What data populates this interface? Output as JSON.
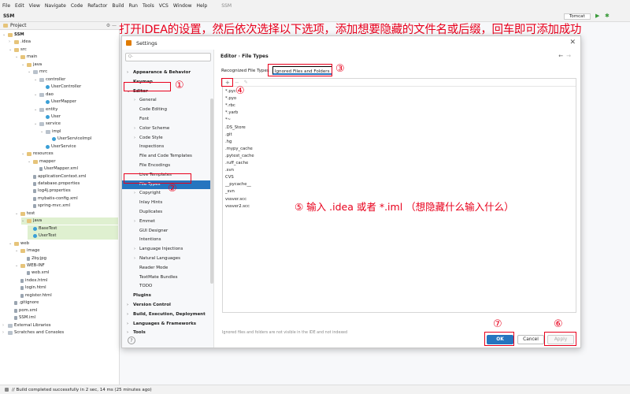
{
  "menu": [
    "File",
    "Edit",
    "View",
    "Navigate",
    "Code",
    "Refactor",
    "Build",
    "Run",
    "Tools",
    "VCS",
    "Window",
    "Help",
    "SSM"
  ],
  "toolbar": {
    "project_name": "SSM",
    "run_config": "Tomcat"
  },
  "project_panel": {
    "label": "Project"
  },
  "tree": [
    {
      "label": "SSM",
      "level": 0,
      "icon": "folder",
      "open": true
    },
    {
      "label": ".idea",
      "level": 1,
      "icon": "folder",
      "open": false
    },
    {
      "label": "src",
      "level": 1,
      "icon": "folder",
      "open": true
    },
    {
      "label": "main",
      "level": 2,
      "icon": "folder",
      "open": true
    },
    {
      "label": "java",
      "level": 3,
      "icon": "folder",
      "open": true
    },
    {
      "label": "mrc",
      "level": 4,
      "icon": "pkg",
      "open": true
    },
    {
      "label": "controller",
      "level": 5,
      "icon": "pkg",
      "open": true
    },
    {
      "label": "UserController",
      "level": 6,
      "icon": "cls"
    },
    {
      "label": "dao",
      "level": 5,
      "icon": "pkg",
      "open": true
    },
    {
      "label": "UserMapper",
      "level": 6,
      "icon": "cls"
    },
    {
      "label": "entity",
      "level": 5,
      "icon": "pkg",
      "open": true
    },
    {
      "label": "User",
      "level": 6,
      "icon": "cls"
    },
    {
      "label": "service",
      "level": 5,
      "icon": "pkg",
      "open": true
    },
    {
      "label": "impl",
      "level": 6,
      "icon": "pkg",
      "open": true
    },
    {
      "label": "UserServiceImpl",
      "level": 7,
      "icon": "cls"
    },
    {
      "label": "UserService",
      "level": 6,
      "icon": "cls"
    },
    {
      "label": "resources",
      "level": 3,
      "icon": "folder",
      "open": true
    },
    {
      "label": "mapper",
      "level": 4,
      "icon": "folder",
      "open": true
    },
    {
      "label": "UserMapper.xml",
      "level": 5,
      "icon": "file"
    },
    {
      "label": "applicationContext.xml",
      "level": 4,
      "icon": "file"
    },
    {
      "label": "database.properties",
      "level": 4,
      "icon": "file"
    },
    {
      "label": "log4j.properties",
      "level": 4,
      "icon": "file"
    },
    {
      "label": "mybatis-config.xml",
      "level": 4,
      "icon": "file"
    },
    {
      "label": "spring-mvc.xml",
      "level": 4,
      "icon": "file"
    },
    {
      "label": "test",
      "level": 2,
      "icon": "folder",
      "open": true
    },
    {
      "label": "java",
      "level": 3,
      "icon": "folder",
      "open": true,
      "highlight": true
    },
    {
      "label": "BaseTest",
      "level": 4,
      "icon": "cls",
      "highlight": true
    },
    {
      "label": "UserTest",
      "level": 4,
      "icon": "cls",
      "highlight": true
    },
    {
      "label": "web",
      "level": 1,
      "icon": "folder",
      "open": true
    },
    {
      "label": "image",
      "level": 2,
      "icon": "folder",
      "open": true
    },
    {
      "label": "2by.jpg",
      "level": 3,
      "icon": "file"
    },
    {
      "label": "WEB-INF",
      "level": 2,
      "icon": "folder",
      "open": true
    },
    {
      "label": "web.xml",
      "level": 3,
      "icon": "file"
    },
    {
      "label": "index.html",
      "level": 2,
      "icon": "file"
    },
    {
      "label": "login.html",
      "level": 2,
      "icon": "file"
    },
    {
      "label": "register.html",
      "level": 2,
      "icon": "file"
    },
    {
      "label": ".gitignore",
      "level": 1,
      "icon": "file"
    },
    {
      "label": "pom.xml",
      "level": 1,
      "icon": "file"
    },
    {
      "label": "SSM.iml",
      "level": 1,
      "icon": "file"
    },
    {
      "label": "External Libraries",
      "level": 0,
      "icon": "pkg",
      "open": false
    },
    {
      "label": "Scratches and Consoles",
      "level": 0,
      "icon": "pkg",
      "open": false
    }
  ],
  "annotation_title": "打开IDEA的设置，然后依次选择以下选项，添加想要隐藏的文件名或后缀，回车即可添加成功",
  "dialog": {
    "title": "Settings",
    "search_placeholder": "Q-",
    "breadcrumb": [
      "Editor",
      "File Types"
    ],
    "sidebar": [
      {
        "label": "Appearance & Behavior",
        "indent": 0,
        "bold": true,
        "arrow": "›"
      },
      {
        "label": "Keymap",
        "indent": 0,
        "bold": true,
        "arrow": ""
      },
      {
        "label": "Editor",
        "indent": 0,
        "bold": true,
        "arrow": "⌄"
      },
      {
        "label": "General",
        "indent": 1,
        "arrow": "›"
      },
      {
        "label": "Code Editing",
        "indent": 1,
        "arrow": ""
      },
      {
        "label": "Font",
        "indent": 1,
        "arrow": ""
      },
      {
        "label": "Color Scheme",
        "indent": 1,
        "arrow": "›"
      },
      {
        "label": "Code Style",
        "indent": 1,
        "arrow": "›"
      },
      {
        "label": "Inspections",
        "indent": 1,
        "arrow": ""
      },
      {
        "label": "File and Code Templates",
        "indent": 1,
        "arrow": ""
      },
      {
        "label": "File Encodings",
        "indent": 1,
        "arrow": ""
      },
      {
        "label": "Live Templates",
        "indent": 1,
        "arrow": ""
      },
      {
        "label": "File Types",
        "indent": 1,
        "arrow": "",
        "selected": true
      },
      {
        "label": "Copyright",
        "indent": 1,
        "arrow": "›"
      },
      {
        "label": "Inlay Hints",
        "indent": 1,
        "arrow": ""
      },
      {
        "label": "Duplicates",
        "indent": 1,
        "arrow": ""
      },
      {
        "label": "Emmet",
        "indent": 1,
        "arrow": "›"
      },
      {
        "label": "GUI Designer",
        "indent": 1,
        "arrow": ""
      },
      {
        "label": "Intentions",
        "indent": 1,
        "arrow": ""
      },
      {
        "label": "Language Injections",
        "indent": 1,
        "arrow": "›"
      },
      {
        "label": "Natural Languages",
        "indent": 1,
        "arrow": "›"
      },
      {
        "label": "Reader Mode",
        "indent": 1,
        "arrow": ""
      },
      {
        "label": "TextMate Bundles",
        "indent": 1,
        "arrow": ""
      },
      {
        "label": "TODO",
        "indent": 1,
        "arrow": ""
      },
      {
        "label": "Plugins",
        "indent": 0,
        "bold": true,
        "arrow": ""
      },
      {
        "label": "Version Control",
        "indent": 0,
        "bold": true,
        "arrow": "›"
      },
      {
        "label": "Build, Execution, Deployment",
        "indent": 0,
        "bold": true,
        "arrow": "›"
      },
      {
        "label": "Languages & Frameworks",
        "indent": 0,
        "bold": true,
        "arrow": "›"
      },
      {
        "label": "Tools",
        "indent": 0,
        "bold": true,
        "arrow": "›"
      }
    ],
    "tabs": [
      "Recognized File Types",
      "Ignored Files and Folders"
    ],
    "ignored": [
      "*.pyc",
      "*.pyo",
      "*.rbc",
      "*.yarb",
      "*~",
      ".DS_Store",
      ".git",
      ".hg",
      ".mypy_cache",
      ".pytest_cache",
      ".ruff_cache",
      ".svn",
      "CVS",
      "__pycache__",
      "_svn",
      "vssver.scc",
      "vssver2.scc"
    ],
    "hint": "Ignored files and folders are not visible in the IDE and not indexed",
    "buttons": {
      "ok": "OK",
      "cancel": "Cancel",
      "apply": "Apply"
    },
    "help": "?"
  },
  "annotations": {
    "n1": "①",
    "n2": "②",
    "n3": "③",
    "n4": "④",
    "n6": "⑥",
    "n7": "⑦",
    "step5": "⑤ 输入 .idea 或者 *.iml （想隐藏什么输入什么）"
  },
  "status": "// Build completed successfully in 2 sec, 14 ms (25 minutes ago)",
  "colors": {
    "accent": "#2675bf",
    "annotation_red": "#e8001c"
  }
}
